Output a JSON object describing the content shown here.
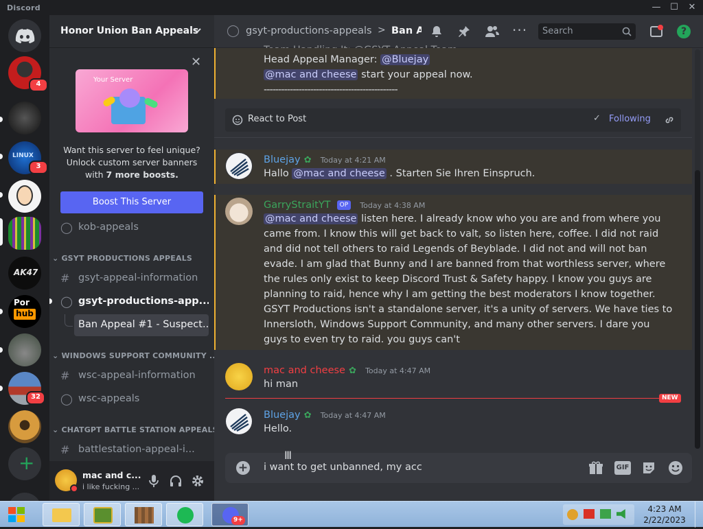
{
  "window": {
    "app_name": "Discord"
  },
  "rail": {
    "badges": [
      "4",
      "3",
      "32"
    ],
    "add_server_icon": "plus-icon"
  },
  "guild": {
    "name": "Honor Union Ban Appeals"
  },
  "boost_card": {
    "banner_label": "Your Server",
    "line1": "Want this server to feel unique?",
    "line2": "Unlock custom server banners",
    "line3_prefix": "with ",
    "line3_bold": "7 more boosts.",
    "button": "Boost This Server"
  },
  "channels": {
    "kob": "kob-appeals",
    "cat_gsyt": "GSYT PRODUCTIONS APPEALS",
    "gsyt_info": "gsyt-appeal-information",
    "gsyt_forum": "gsyt-productions-app...",
    "thread": "Ban Appeal #1 - Suspect...",
    "cat_wsc": "WINDOWS SUPPORT COMMUNITY ...",
    "wsc_info": "wsc-appeal-information",
    "wsc_forum": "wsc-appeals",
    "cat_chatgpt": "CHATGPT BATTLE STATION APPEALS",
    "battle": "battlestation-appeal-i..."
  },
  "user": {
    "name": "mac and c...",
    "status": "i like fucking ..."
  },
  "topbar": {
    "channel": "gsyt-productions-appeals",
    "sep": ">",
    "thread": "Ban A",
    "search_placeholder": "Search"
  },
  "post": {
    "line_partial": "Team Handling It: @GSYT Appeal Team",
    "line1_label": "Head Appeal Manager: ",
    "line1_mention": "@Bluejay",
    "line2_mention": "@mac and cheese",
    "line2_text": " start your appeal now.",
    "line3": "----------------------------------------------",
    "react": "React to Post",
    "following": "Following"
  },
  "messages": [
    {
      "author": "Bluejay",
      "time": "Today at 4:21 AM",
      "mention": "@mac and cheese",
      "text": " . Starten Sie Ihren Einspruch.",
      "prefix": "Hallo "
    },
    {
      "author": "GarryStraitYT",
      "tag": "OP",
      "time": "Today at 4:38 AM",
      "mention": "@mac and cheese",
      "text": " listen here. I already know who you are and from where you came from. I know this will get back to valt, so listen here, coffee. I did not raid and did not tell others to raid Legends of Beyblade. I did not and will not ban evade. I am glad that Bunny and I are banned from that worthless server, where the rules only exist to keep Discord Trust & Safety happy. I know you guys are planning to raid, hence why I am getting the best moderators I know together. GSYT Productions isn't a standalone server, it's a unity of servers. We have ties to Innersloth, Windows Support Community, and many other servers. I dare you guys to even try to raid. you guys can't"
    },
    {
      "author": "mac and cheese",
      "time": "Today at 4:47 AM",
      "text": "hi man"
    },
    {
      "author": "Bluejay",
      "time": "Today at 4:47 AM",
      "text": "Hello."
    }
  ],
  "new_label": "NEW",
  "composer": {
    "value": "i want to get unbanned, my acc",
    "gif": "GIF"
  },
  "taskbar": {
    "time": "4:23 AM",
    "date": "2/22/2023",
    "discord_badge": "9+"
  },
  "colors": {
    "blurple": "#5865f2",
    "red_name": "#f23f43",
    "blue_name": "#5ea3e6",
    "green_name": "#3ba55c",
    "mention_bg": "#3c4270"
  }
}
